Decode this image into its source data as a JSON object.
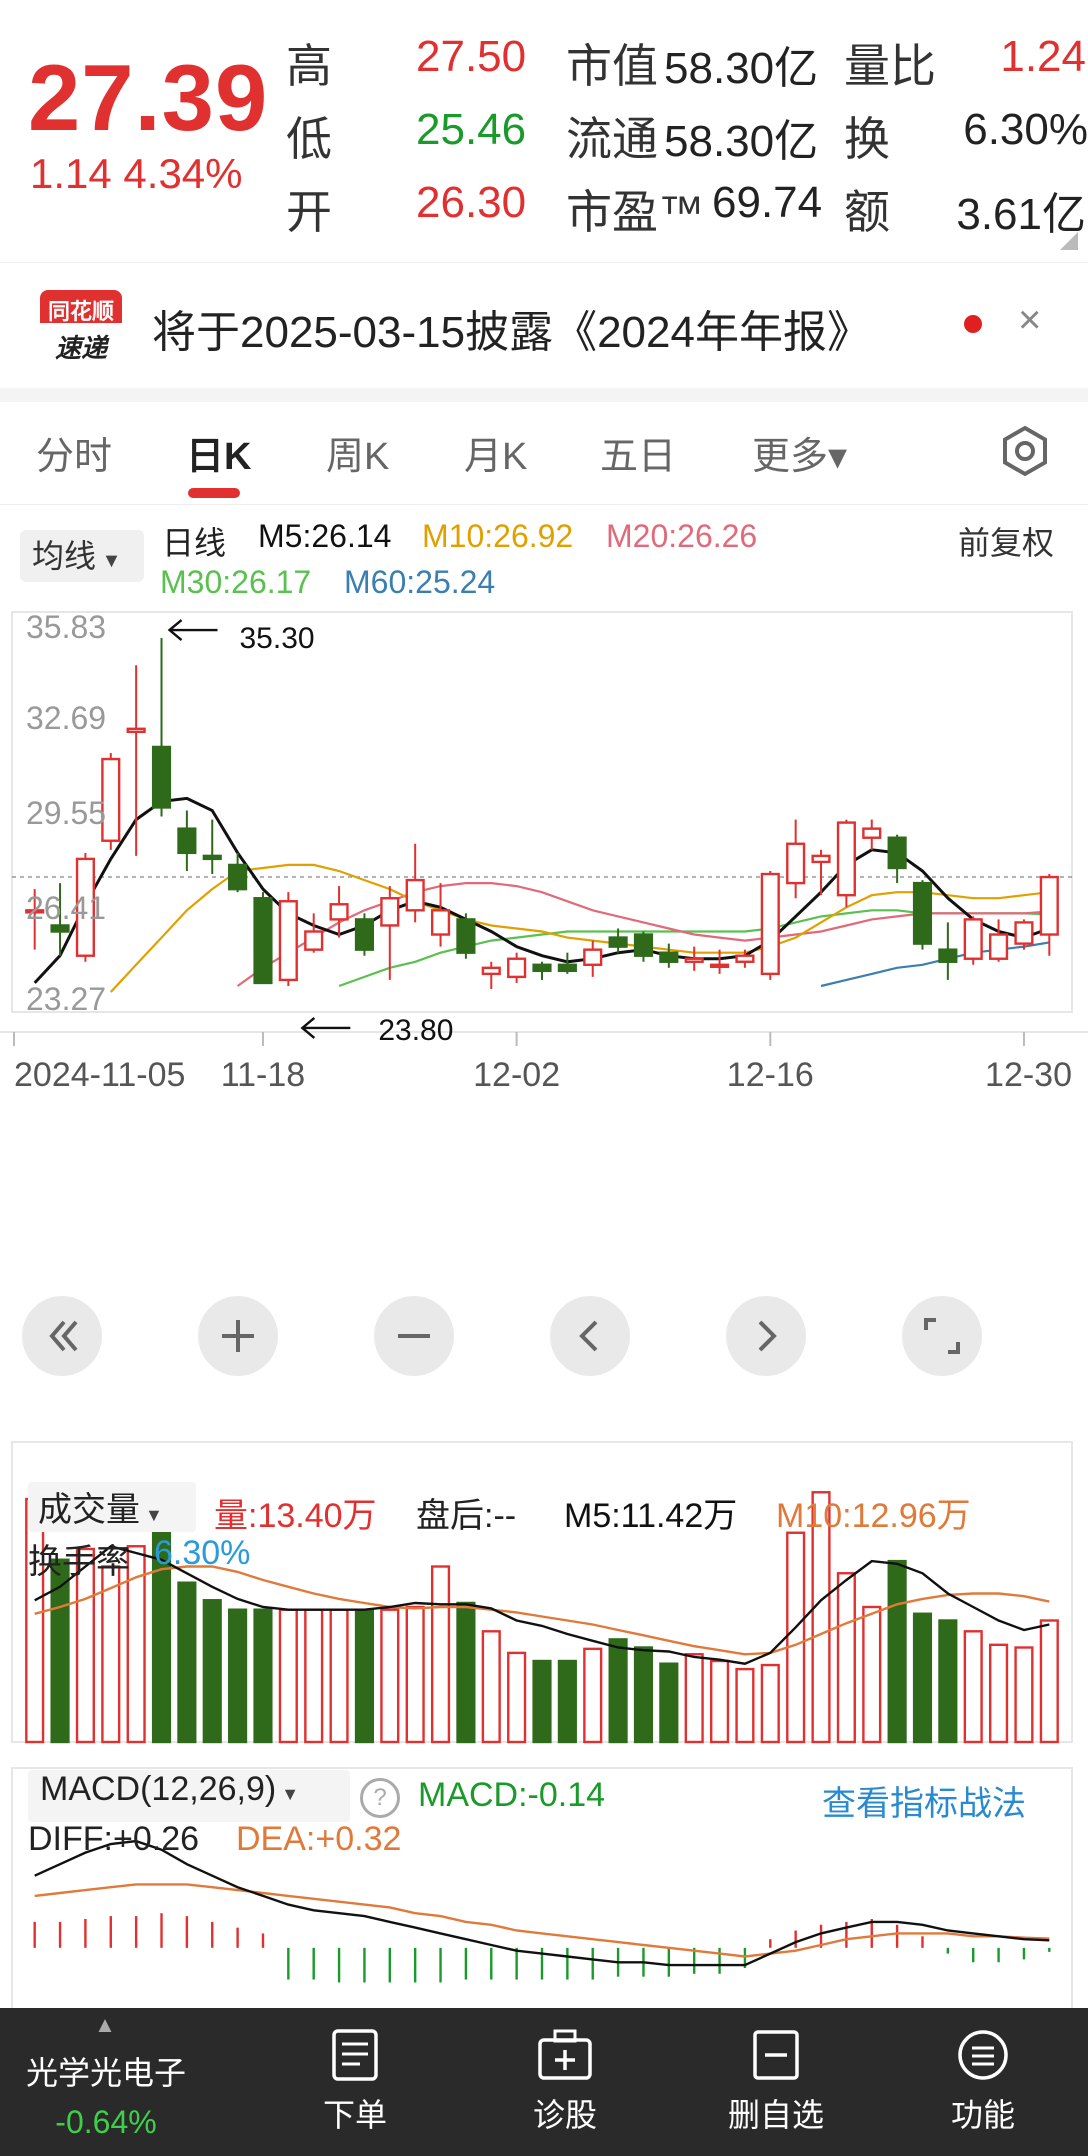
{
  "quote": {
    "price": "27.39",
    "change": "1.14  4.34%",
    "rows": [
      {
        "l1": "高",
        "v1": "27.50",
        "l2": "市值",
        "v2": "58.30亿",
        "l3": "量比",
        "v3": "1.24"
      },
      {
        "l1": "低",
        "v1": "25.46",
        "l2": "流通",
        "v2": "58.30亿",
        "l3": "换",
        "v3": "6.30%"
      },
      {
        "l1": "开",
        "v1": "26.30",
        "l2": "市盈™",
        "v2": "69.74",
        "l3": "额",
        "v3": "3.61亿"
      }
    ]
  },
  "notice": {
    "logo_top": "同花顺",
    "logo_bottom": "速递",
    "text": "将于2025-03-15披露《2024年年报》",
    "close": "×"
  },
  "tabs": [
    "分时",
    "日K",
    "周K",
    "月K",
    "五日",
    "更多▾"
  ],
  "ma_bar": {
    "select": "均线",
    "period": "日线",
    "adjust": "前复权",
    "m5": "M5:26.14",
    "m10": "M10:26.92",
    "m20": "M20:26.26",
    "m30": "M30:26.17",
    "m60": "M60:25.24"
  },
  "colors": {
    "up": "#e03030",
    "down": "#2e6a1a",
    "m5": "#111111",
    "m10": "#e0a000",
    "m20": "#e06a7a",
    "m30": "#5ac050",
    "m60": "#3a7fb0",
    "dea": "#e07a3a"
  },
  "annotations": {
    "high": "35.30",
    "low": "23.80"
  },
  "chart_data": [
    {
      "type": "candlestick",
      "y_ticks": [
        "35.83",
        "32.69",
        "29.55",
        "26.41",
        "23.27"
      ],
      "ylim": [
        23.27,
        35.83
      ],
      "x_ticks": [
        "2024-11-05",
        "11-18",
        "12-02",
        "12-16",
        "12-30"
      ],
      "candles": [
        {
          "o": 26.3,
          "c": 26.3,
          "h": 27.0,
          "l": 25.0
        },
        {
          "o": 25.8,
          "c": 25.6,
          "h": 27.2,
          "l": 24.8
        },
        {
          "o": 24.8,
          "c": 28.0,
          "h": 28.2,
          "l": 24.6
        },
        {
          "o": 28.6,
          "c": 31.3,
          "h": 31.5,
          "l": 28.3
        },
        {
          "o": 32.2,
          "c": 32.3,
          "h": 34.4,
          "l": 28.1
        },
        {
          "o": 31.7,
          "c": 29.7,
          "h": 35.3,
          "l": 29.4
        },
        {
          "o": 29.0,
          "c": 28.2,
          "h": 29.6,
          "l": 27.6
        },
        {
          "o": 28.1,
          "c": 28.0,
          "h": 29.3,
          "l": 27.5
        },
        {
          "o": 27.8,
          "c": 27.0,
          "h": 28.2,
          "l": 26.9
        },
        {
          "o": 26.7,
          "c": 23.9,
          "h": 26.9,
          "l": 23.9
        },
        {
          "o": 24.0,
          "c": 26.6,
          "h": 26.9,
          "l": 23.8
        },
        {
          "o": 25.0,
          "c": 25.6,
          "h": 26.2,
          "l": 24.9
        },
        {
          "o": 26.0,
          "c": 26.5,
          "h": 27.1,
          "l": 25.4
        },
        {
          "o": 26.0,
          "c": 25.0,
          "h": 26.2,
          "l": 24.8
        },
        {
          "o": 25.8,
          "c": 26.7,
          "h": 27.1,
          "l": 24.0
        },
        {
          "o": 26.3,
          "c": 27.3,
          "h": 28.5,
          "l": 25.9
        },
        {
          "o": 25.5,
          "c": 26.3,
          "h": 27.2,
          "l": 25.1
        },
        {
          "o": 26.0,
          "c": 24.9,
          "h": 26.2,
          "l": 24.7
        },
        {
          "o": 24.2,
          "c": 24.4,
          "h": 24.6,
          "l": 23.7
        },
        {
          "o": 24.1,
          "c": 24.7,
          "h": 24.9,
          "l": 23.9
        },
        {
          "o": 24.5,
          "c": 24.3,
          "h": 24.6,
          "l": 24.0
        },
        {
          "o": 24.5,
          "c": 24.3,
          "h": 24.9,
          "l": 24.2
        },
        {
          "o": 24.5,
          "c": 25.0,
          "h": 25.3,
          "l": 24.1
        },
        {
          "o": 25.4,
          "c": 25.1,
          "h": 25.7,
          "l": 24.9
        },
        {
          "o": 25.5,
          "c": 24.8,
          "h": 25.6,
          "l": 24.6
        },
        {
          "o": 24.9,
          "c": 24.6,
          "h": 25.2,
          "l": 24.4
        },
        {
          "o": 24.6,
          "c": 24.7,
          "h": 25.1,
          "l": 24.3
        },
        {
          "o": 24.5,
          "c": 24.5,
          "h": 25.0,
          "l": 24.2
        },
        {
          "o": 24.6,
          "c": 24.8,
          "h": 25.0,
          "l": 24.4
        },
        {
          "o": 24.2,
          "c": 27.5,
          "h": 27.6,
          "l": 24.0
        },
        {
          "o": 27.2,
          "c": 28.5,
          "h": 29.3,
          "l": 26.7
        },
        {
          "o": 27.9,
          "c": 28.1,
          "h": 28.3,
          "l": 26.8
        },
        {
          "o": 26.8,
          "c": 29.2,
          "h": 29.3,
          "l": 26.4
        },
        {
          "o": 28.7,
          "c": 29.0,
          "h": 29.3,
          "l": 28.3
        },
        {
          "o": 28.7,
          "c": 27.7,
          "h": 28.8,
          "l": 27.2
        },
        {
          "o": 27.2,
          "c": 25.2,
          "h": 27.3,
          "l": 25.0
        },
        {
          "o": 25.0,
          "c": 24.6,
          "h": 25.9,
          "l": 24.0
        },
        {
          "o": 24.7,
          "c": 26.0,
          "h": 26.1,
          "l": 24.5
        },
        {
          "o": 24.7,
          "c": 25.5,
          "h": 26.0,
          "l": 24.6
        },
        {
          "o": 25.2,
          "c": 25.9,
          "h": 26.0,
          "l": 25.0
        },
        {
          "o": 25.5,
          "c": 27.4,
          "h": 27.5,
          "l": 24.8
        }
      ],
      "ma5": [
        23.9,
        24.8,
        26.5,
        28.0,
        29.3,
        29.9,
        30.0,
        29.6,
        28.2,
        27.0,
        26.2,
        25.8,
        25.5,
        25.8,
        26.3,
        26.6,
        26.4,
        26.0,
        25.6,
        25.1,
        24.8,
        24.6,
        24.7,
        24.9,
        25.0,
        24.8,
        24.7,
        24.7,
        24.8,
        25.3,
        26.1,
        26.9,
        27.8,
        28.3,
        28.2,
        27.6,
        26.7,
        26.0,
        25.6,
        25.4,
        25.7
      ],
      "ma10": [
        null,
        null,
        null,
        23.6,
        24.5,
        25.4,
        26.3,
        27.0,
        27.6,
        27.7,
        27.8,
        27.8,
        27.6,
        27.3,
        27.0,
        26.6,
        26.3,
        26.0,
        25.8,
        25.7,
        25.6,
        25.4,
        25.3,
        25.2,
        25.1,
        25.0,
        24.9,
        24.9,
        24.9,
        25.1,
        25.4,
        25.9,
        26.4,
        26.8,
        26.9,
        26.9,
        26.8,
        26.7,
        26.7,
        26.8,
        26.9
      ],
      "ma20": [
        null,
        null,
        null,
        null,
        null,
        null,
        null,
        null,
        23.8,
        24.4,
        24.9,
        25.4,
        25.9,
        26.3,
        26.6,
        26.9,
        27.1,
        27.2,
        27.2,
        27.1,
        26.9,
        26.6,
        26.3,
        26.1,
        25.9,
        25.7,
        25.5,
        25.4,
        25.3,
        25.4,
        25.5,
        25.6,
        25.8,
        26.0,
        26.1,
        26.2,
        26.2,
        26.2,
        26.2,
        26.2,
        26.26
      ],
      "ma30": [
        null,
        null,
        null,
        null,
        null,
        null,
        null,
        null,
        null,
        null,
        null,
        null,
        23.8,
        24.1,
        24.4,
        24.6,
        24.9,
        25.1,
        25.3,
        25.4,
        25.5,
        25.6,
        25.6,
        25.6,
        25.6,
        25.6,
        25.6,
        25.6,
        25.6,
        25.7,
        25.9,
        26.1,
        26.2,
        26.3,
        26.3,
        26.2,
        26.2,
        26.2,
        26.2,
        26.2,
        26.17
      ],
      "ma60": [
        null,
        null,
        null,
        null,
        null,
        null,
        null,
        null,
        null,
        null,
        null,
        null,
        null,
        null,
        null,
        null,
        null,
        null,
        null,
        null,
        null,
        null,
        null,
        null,
        null,
        null,
        null,
        null,
        null,
        null,
        null,
        23.8,
        24.0,
        24.2,
        24.4,
        24.5,
        24.7,
        24.9,
        25.0,
        25.1,
        25.24
      ]
    },
    {
      "type": "bar",
      "title": "成交量",
      "labels": {
        "vol": "量:13.40万",
        "after": "盘后:--",
        "m5": "M5:11.42万",
        "m10": "M10:12.96万",
        "turnover_label": "换手率",
        "turnover": "6.30%"
      },
      "values": [
        18.0,
        13.5,
        14.3,
        13.0,
        14.5,
        18.5,
        11.8,
        10.5,
        9.8,
        9.8,
        9.8,
        9.8,
        9.8,
        9.8,
        9.8,
        10.0,
        13.0,
        10.3,
        8.2,
        6.6,
        6.0,
        6.0,
        6.9,
        7.6,
        7.0,
        5.8,
        6.5,
        6.0,
        5.4,
        5.7,
        15.5,
        18.5,
        12.5,
        10.0,
        13.4,
        9.5,
        9.0,
        8.2,
        7.2,
        7.0,
        9.0
      ],
      "ma5": [
        10.5,
        11.5,
        13.0,
        14.5,
        14.0,
        13.5,
        12.5,
        11.5,
        10.6,
        10.0,
        9.8,
        9.8,
        9.8,
        9.8,
        10.0,
        10.3,
        10.2,
        10.2,
        9.9,
        9.0,
        8.6,
        8.0,
        7.5,
        7.0,
        6.8,
        6.7,
        6.3,
        6.1,
        5.8,
        6.6,
        8.5,
        10.5,
        12.0,
        13.4,
        13.2,
        12.5,
        11.0,
        10.0,
        9.0,
        8.3,
        8.7
      ],
      "ma10": [
        9.5,
        10.0,
        10.6,
        11.4,
        12.2,
        12.8,
        13.0,
        13.0,
        12.6,
        12.0,
        11.5,
        11.0,
        10.6,
        10.3,
        10.0,
        9.9,
        10.0,
        10.0,
        9.8,
        9.6,
        9.3,
        9.0,
        8.7,
        8.3,
        7.9,
        7.5,
        7.1,
        6.8,
        6.5,
        6.6,
        7.2,
        8.0,
        8.8,
        9.5,
        10.2,
        10.6,
        10.9,
        11.0,
        11.0,
        10.8,
        10.4
      ],
      "ylim": [
        0,
        20
      ]
    },
    {
      "type": "bar",
      "title": "MACD(12,26,9)",
      "labels": {
        "macd": "MACD:-0.14",
        "diff": "DIFF:+0.26",
        "dea": "DEA:+0.32",
        "link": "查看指标战法"
      },
      "hist": [
        0.9,
        0.9,
        1.0,
        1.1,
        1.1,
        1.2,
        1.1,
        0.9,
        0.7,
        0.5,
        -1.1,
        -1.1,
        -1.2,
        -1.2,
        -1.2,
        -1.2,
        -1.2,
        -1.1,
        -1.1,
        -1.1,
        -1.1,
        -1.1,
        -1.1,
        -1.0,
        -1.0,
        -1.0,
        -0.9,
        -0.9,
        -0.7,
        0.3,
        0.6,
        0.8,
        0.9,
        1.0,
        0.8,
        0.4,
        -0.2,
        -0.5,
        -0.5,
        -0.4,
        -0.14
      ],
      "diff": [
        2.5,
        2.9,
        3.3,
        3.6,
        3.7,
        3.4,
        2.9,
        2.5,
        2.1,
        1.8,
        1.5,
        1.3,
        1.2,
        1.1,
        0.9,
        0.7,
        0.5,
        0.3,
        0.1,
        -0.1,
        -0.2,
        -0.3,
        -0.4,
        -0.5,
        -0.5,
        -0.6,
        -0.6,
        -0.6,
        -0.6,
        -0.2,
        0.2,
        0.5,
        0.7,
        0.9,
        0.9,
        0.8,
        0.6,
        0.5,
        0.4,
        0.3,
        0.26
      ],
      "dea": [
        1.8,
        1.9,
        2.0,
        2.1,
        2.2,
        2.2,
        2.2,
        2.1,
        2.0,
        1.9,
        1.8,
        1.7,
        1.6,
        1.5,
        1.4,
        1.2,
        1.1,
        0.9,
        0.8,
        0.6,
        0.5,
        0.4,
        0.3,
        0.2,
        0.1,
        0.0,
        -0.1,
        -0.2,
        -0.3,
        -0.2,
        -0.1,
        0.1,
        0.3,
        0.4,
        0.5,
        0.5,
        0.5,
        0.4,
        0.4,
        0.35,
        0.32
      ],
      "ylim": [
        -1.6,
        4.5
      ]
    }
  ],
  "bottom": {
    "stock_name": "光学光电子",
    "stock_change": "-0.64%",
    "buttons": [
      "下单",
      "诊股",
      "删自选",
      "功能"
    ]
  }
}
